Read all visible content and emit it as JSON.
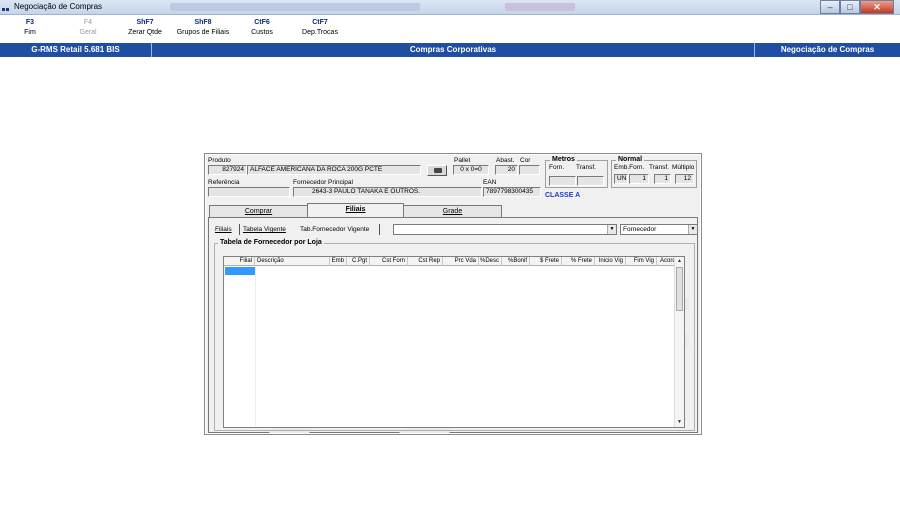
{
  "window": {
    "title": "Negociação de Compras"
  },
  "fkeys": [
    {
      "key": "F3",
      "label": "Fim",
      "disabled": false
    },
    {
      "key": "F4",
      "label": "Geral",
      "disabled": true
    },
    {
      "key": "ShF7",
      "label": "Zerar Qtde",
      "disabled": false
    },
    {
      "key": "ShF8",
      "label": "Grupos de Filiais",
      "disabled": false
    },
    {
      "key": "CtF6",
      "label": "Custos",
      "disabled": false
    },
    {
      "key": "CtF7",
      "label": "Dep.Trocas",
      "disabled": false
    }
  ],
  "statusbar": {
    "version": "G-RMS Retail 5.681 BIS",
    "module": "Compras Corporativas",
    "screen": "Negociação de Compras"
  },
  "product": {
    "produto_label": "Produto",
    "codigo": "827924",
    "descricao": "ALFACE AMERICANA DA ROCA 200G PCTE",
    "pallet_label": "Pallet",
    "pallet": "0 x 0=0",
    "abast_label": "Abast.",
    "abast": "20",
    "cor_label": "Cor",
    "cor": "",
    "referencia_label": "Referência",
    "referencia": "",
    "fornecedor_label": "Fornecedor Principal",
    "fornecedor": "2643-3 PAULO TANAKA E OUTROS.",
    "ean_label": "EAN",
    "ean": "7897798300435",
    "classe": "CLASSE A"
  },
  "metros": {
    "title": "Metros",
    "forn_label": "Forn.",
    "transf_label": "Transf.",
    "forn": "",
    "transf": ""
  },
  "normal": {
    "title": "Normal",
    "emb_label": "Emb.Forn.",
    "transf_label": "Transf.",
    "multiplo_label": "Múltiplo",
    "emb_unit": "UN",
    "emb": "1",
    "transf": "1",
    "multiplo": "12"
  },
  "tabs": [
    {
      "label": "Comprar",
      "active": false
    },
    {
      "label": "Filiais",
      "active": true
    },
    {
      "label": "Grade",
      "active": false
    }
  ],
  "subtabs": {
    "filiais": "Filiais",
    "tabela_vigente": "Tabela Vigente",
    "tab_fornecedor": "Tab.Fornecedor Vigente"
  },
  "combo_filtro": {
    "value": ""
  },
  "combo_tipo": {
    "value": "Fornecedor"
  },
  "table": {
    "title": "Tabela de Fornecedor por Loja",
    "columns": [
      "Filial",
      "Descrição",
      "Emb",
      "C.Pgt",
      "Cst Forn",
      "Cst Rep",
      "Prc Vda",
      "%Desc",
      "%Bonif",
      "$ Frete",
      "% Frete",
      "Inicio Vig",
      "Fim Vig",
      "Acordo"
    ],
    "rows": []
  }
}
